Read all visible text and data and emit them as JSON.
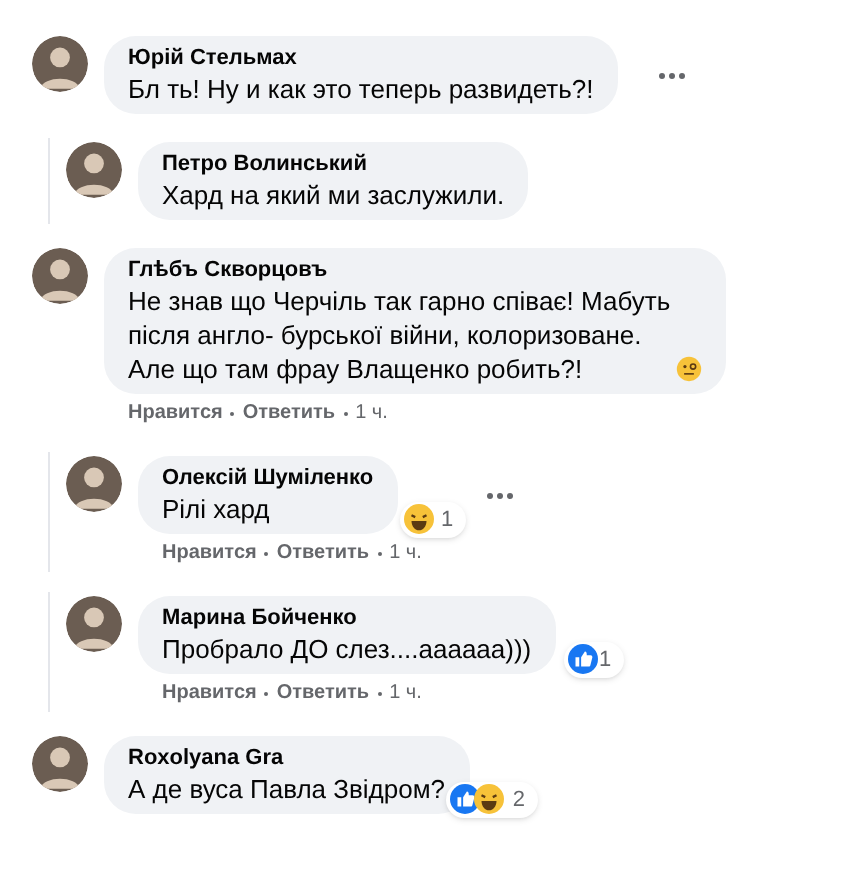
{
  "comments": [
    {
      "author": "Юрій Стельмах",
      "text": "Бл ть! Ну и как это теперь развидеть?!",
      "reply": false,
      "more": true
    },
    {
      "author": "Петро Волинський",
      "text": "Хард на який ми заслужили.",
      "reply": true,
      "more": false
    },
    {
      "author": "Глѣбъ Скворцовъ",
      "text": "Не знав що Черчіль так гарно співає! Мабуть після англо- бурської війни, колоризоване. Але що там фрау Влащенко робить?!",
      "reply": false,
      "more": false,
      "emoji": true,
      "meta": {
        "like": "Нравится",
        "answer": "Ответить",
        "time": "1 ч."
      }
    },
    {
      "author": "Олексій Шуміленко",
      "text": "Рілі хард",
      "reply": true,
      "more": true,
      "reactions": {
        "like": false,
        "haha": true,
        "count": "1"
      },
      "meta": {
        "like": "Нравится",
        "answer": "Ответить",
        "time": "1 ч."
      }
    },
    {
      "author": "Марина Бойченко",
      "text": "Пробрало ДО слез....аааааа)))",
      "reply": true,
      "more": false,
      "reactions": {
        "like": true,
        "haha": false,
        "count": "1"
      },
      "meta": {
        "like": "Нравится",
        "answer": "Ответить",
        "time": "1 ч."
      }
    },
    {
      "author": "Roxolyana Gra",
      "text": "А де вуса Павла Звідром?",
      "reply": false,
      "more": false,
      "reactions": {
        "like": true,
        "haha": true,
        "count": "2"
      }
    }
  ]
}
